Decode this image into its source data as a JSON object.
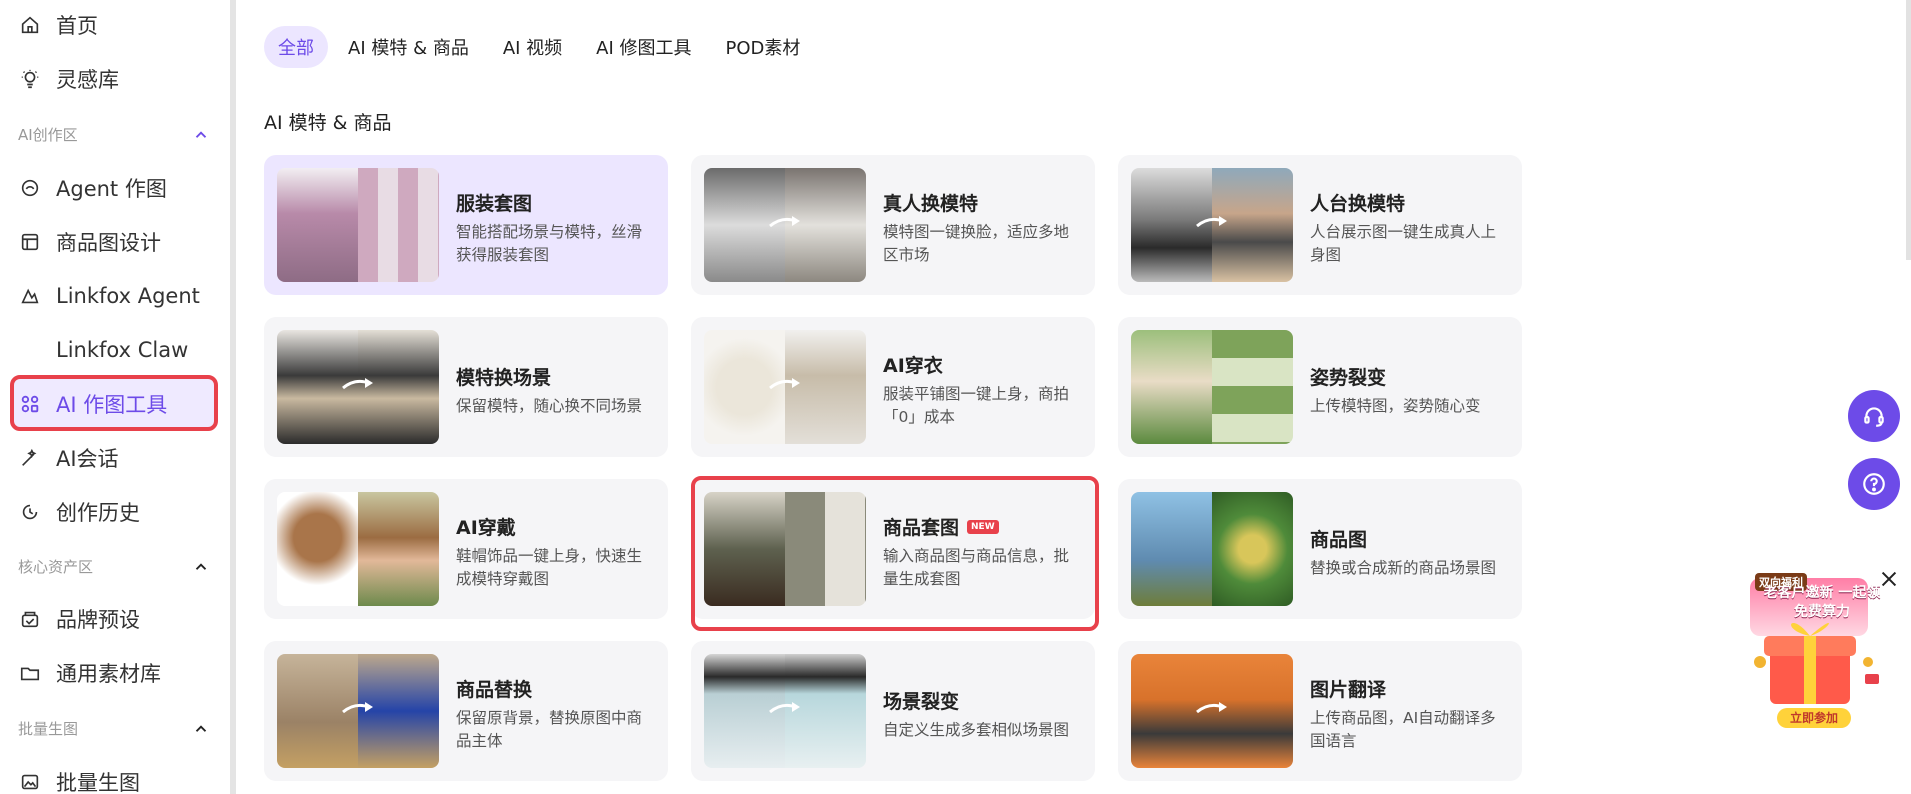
{
  "sidebar": {
    "items": [
      {
        "label": "首页",
        "icon": "home-icon"
      },
      {
        "label": "灵感库",
        "icon": "bulb-icon"
      },
      {
        "label": "Agent 作图",
        "icon": "agent-icon"
      },
      {
        "label": "商品图设计",
        "icon": "layout-icon"
      },
      {
        "label": "Linkfox Agent",
        "icon": "linkfox-agent-icon"
      },
      {
        "label": "Linkfox Claw",
        "icon": "claw-icon"
      },
      {
        "label": "AI 作图工具",
        "icon": "grid-icon"
      },
      {
        "label": "AI会话",
        "icon": "magic-wand-icon"
      },
      {
        "label": "创作历史",
        "icon": "history-icon"
      },
      {
        "label": "品牌预设",
        "icon": "brand-icon"
      },
      {
        "label": "通用素材库",
        "icon": "folder-icon"
      },
      {
        "label": "批量生图",
        "icon": "image-icon"
      }
    ],
    "sections": [
      {
        "label": "AI创作区"
      },
      {
        "label": "核心资产区"
      },
      {
        "label": "批量生图"
      }
    ],
    "accent": "#6d4be8"
  },
  "tabs": [
    {
      "label": "全部"
    },
    {
      "label": "AI 模特 & 商品"
    },
    {
      "label": "AI 视频"
    },
    {
      "label": "AI 修图工具"
    },
    {
      "label": "POD素材"
    }
  ],
  "section_title": "AI 模特 & 商品",
  "cards": [
    {
      "title": "服装套图",
      "desc": "智能搭配场景与模特，丝滑获得服装套图"
    },
    {
      "title": "真人换模特",
      "desc": "模特图一键换脸，适应多地区市场"
    },
    {
      "title": "人台换模特",
      "desc": "人台展示图一键生成真人上身图"
    },
    {
      "title": "模特换场景",
      "desc": "保留模特，随心换不同场景"
    },
    {
      "title": "AI穿衣",
      "desc": "服装平铺图一键上身，商拍「0」成本"
    },
    {
      "title": "姿势裂变",
      "desc": "上传模特图，姿势随心变"
    },
    {
      "title": "AI穿戴",
      "desc": "鞋帽饰品一键上身，快速生成模特穿戴图"
    },
    {
      "title": "商品套图",
      "desc": "输入商品图与商品信息，批量生成套图",
      "badge": "NEW"
    },
    {
      "title": "商品图",
      "desc": "替换或合成新的商品场景图"
    },
    {
      "title": "商品替换",
      "desc": "保留原背景，替换原图中商品主体"
    },
    {
      "title": "场景裂变",
      "desc": "自定义生成多套相似场景图"
    },
    {
      "title": "图片翻译",
      "desc": "上传商品图，AI自动翻译多国语言"
    }
  ],
  "promo": {
    "tag": "双向福利",
    "headline": "老客户邀新 一起领免费算力",
    "cta": "立即参加"
  },
  "float_buttons": [
    {
      "icon": "headset-icon"
    },
    {
      "icon": "help-icon"
    }
  ]
}
